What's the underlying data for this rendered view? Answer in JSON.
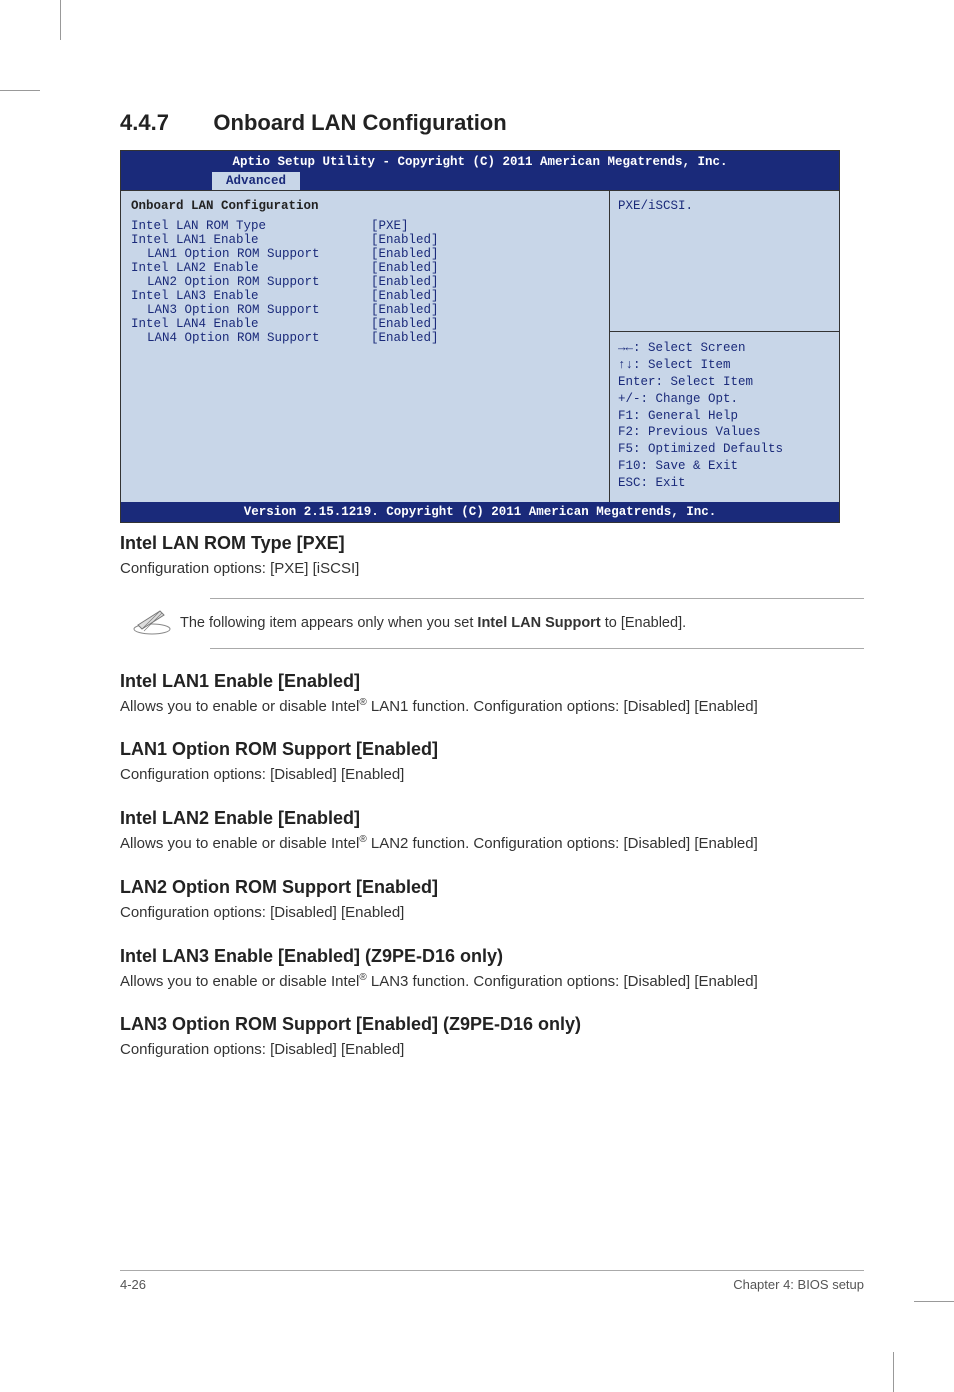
{
  "section": {
    "number": "4.4.7",
    "title": "Onboard LAN Configuration"
  },
  "bios": {
    "top_title": "Aptio Setup Utility - Copyright (C) 2011 American Megatrends, Inc.",
    "tab": "Advanced",
    "panel_heading": "Onboard LAN Configuration",
    "rows": [
      {
        "label": "Intel LAN ROM Type",
        "value": "[PXE]",
        "indent": false
      },
      {
        "label": "Intel LAN1 Enable",
        "value": "[Enabled]",
        "indent": false
      },
      {
        "label": "LAN1 Option ROM Support",
        "value": "[Enabled]",
        "indent": true
      },
      {
        "label": "Intel LAN2 Enable",
        "value": "[Enabled]",
        "indent": false
      },
      {
        "label": "LAN2 Option ROM Support",
        "value": "[Enabled]",
        "indent": true
      },
      {
        "label": "Intel LAN3 Enable",
        "value": "[Enabled]",
        "indent": false
      },
      {
        "label": "LAN3 Option ROM Support",
        "value": "[Enabled]",
        "indent": true
      },
      {
        "label": "Intel LAN4 Enable",
        "value": "[Enabled]",
        "indent": false
      },
      {
        "label": "LAN4 Option ROM Support",
        "value": "[Enabled]",
        "indent": true
      }
    ],
    "help_top": "PXE/iSCSI.",
    "help_keys": [
      "→←: Select Screen",
      "↑↓:  Select Item",
      "Enter: Select Item",
      "+/-: Change Opt.",
      "F1: General Help",
      "F2: Previous Values",
      "F5: Optimized Defaults",
      "F10: Save & Exit",
      "ESC: Exit"
    ],
    "footer": "Version 2.15.1219. Copyright (C) 2011 American Megatrends, Inc."
  },
  "body": {
    "s1": {
      "h": "Intel LAN ROM Type [PXE]",
      "p": "Configuration options: [PXE] [iSCSI]"
    },
    "note": {
      "text_a": "The following item appears only when you set ",
      "bold": "Intel LAN Support",
      "text_b": " to [Enabled]."
    },
    "s2": {
      "h": "Intel LAN1 Enable [Enabled]",
      "p1a": "Allows you to enable or disable Intel",
      "p1b": " LAN1 function. Configuration options: [Disabled] [Enabled]"
    },
    "s3": {
      "h": "LAN1 Option ROM Support [Enabled]",
      "p": "Configuration options: [Disabled] [Enabled]"
    },
    "s4": {
      "h": "Intel LAN2 Enable [Enabled]",
      "p1a": "Allows you to enable or disable Intel",
      "p1b": "  LAN2 function. Configuration options: [Disabled] [Enabled]"
    },
    "s5": {
      "h": "LAN2 Option ROM Support [Enabled]",
      "p": "Configuration options: [Disabled] [Enabled]"
    },
    "s6": {
      "h": "Intel LAN3 Enable [Enabled] (Z9PE-D16 only)",
      "p1a": "Allows you to enable or disable Intel",
      "p1b": " LAN3 function. Configuration options: [Disabled] [Enabled]"
    },
    "s7": {
      "h": "LAN3 Option ROM Support [Enabled] (Z9PE-D16 only)",
      "p": "Configuration options: [Disabled] [Enabled]"
    }
  },
  "footer": {
    "left": "4-26",
    "right": "Chapter 4: BIOS setup"
  },
  "reg": "®"
}
